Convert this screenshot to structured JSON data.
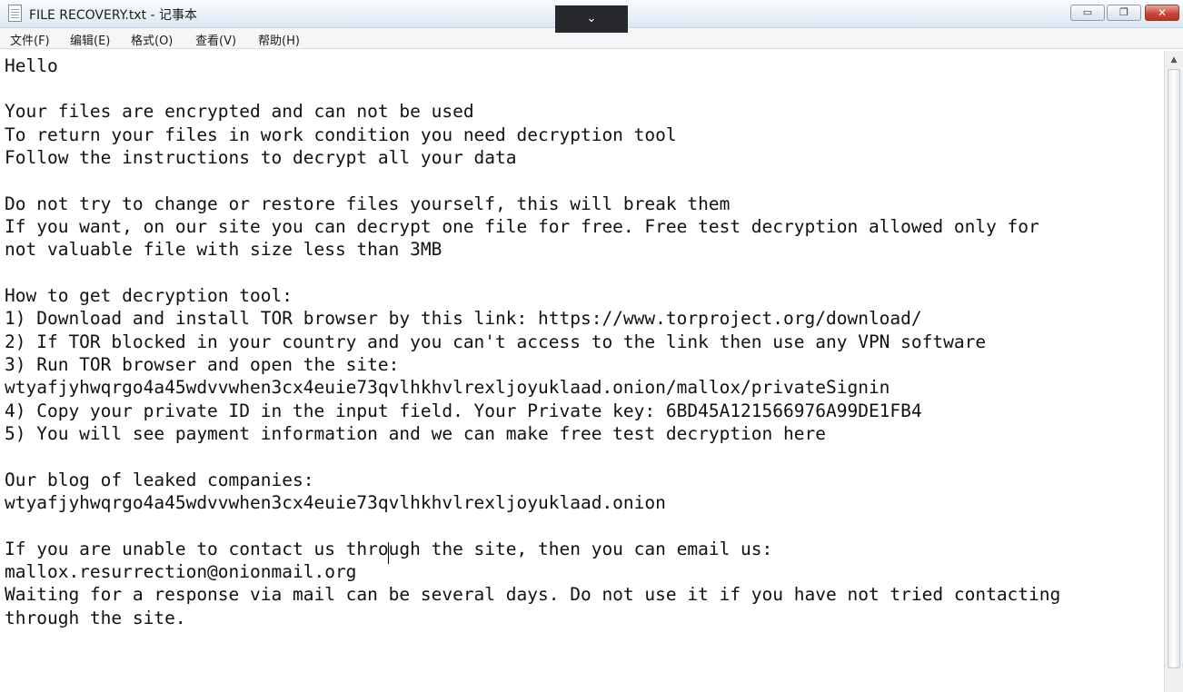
{
  "window": {
    "title": "FILE RECOVERY.txt - 记事本",
    "icon": "notepad-icon",
    "controls": {
      "minimize": "minimize-icon",
      "maximize": "restore-icon",
      "close": "close-icon",
      "minimize_glyph": "▭",
      "maximize_glyph": "❐",
      "close_glyph": "✕"
    }
  },
  "overlay": {
    "glyph": "⌄",
    "icon": "chevron-down-icon"
  },
  "menu": [
    {
      "label": "文件(F)"
    },
    {
      "label": "编辑(E)"
    },
    {
      "label": "格式(O)"
    },
    {
      "label": "查看(V)"
    },
    {
      "label": "帮助(H)"
    }
  ],
  "document": {
    "lines": [
      "Hello",
      "",
      "Your files are encrypted and can not be used",
      "To return your files in work condition you need decryption tool",
      "Follow the instructions to decrypt all your data",
      "",
      "Do not try to change or restore files yourself, this will break them",
      "If you want, on our site you can decrypt one file for free. Free test decryption allowed only for",
      "not valuable file with size less than 3MB",
      "",
      "How to get decryption tool:",
      "1) Download and install TOR browser by this link: https://www.torproject.org/download/",
      "2) If TOR blocked in your country and you can't access to the link then use any VPN software",
      "3) Run TOR browser and open the site:",
      "wtyafjyhwqrgo4a45wdvvwhen3cx4euie73qvlhkhvlrexljoyuklaad.onion/mallox/privateSignin",
      "4) Copy your private ID in the input field. Your Private key: 6BD45A121566976A99DE1FB4",
      "5) You will see payment information and we can make free test decryption here",
      "",
      "Our blog of leaked companies:",
      "wtyafjyhwqrgo4a45wdvvwhen3cx4euie73qvlhkhvlrexljoyuklaad.onion",
      "",
      "If you are unable to contact us through the site, then you can email us:",
      "mallox.resurrection@onionmail.org",
      "Waiting for a response via mail can be several days. Do not use it if you have not tried contacting",
      "through the site."
    ]
  },
  "scrollbar": {
    "up_glyph": "▲",
    "up_icon": "scroll-up-arrow-icon"
  }
}
